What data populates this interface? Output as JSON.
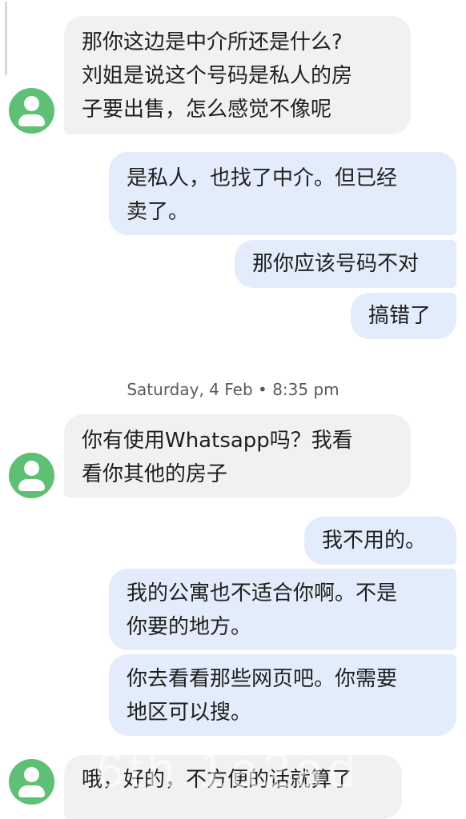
{
  "conversation": {
    "messages": [
      {
        "direction": "incoming",
        "text": "那你这边是中介所还是什么?\n刘姐是说这个号码是私人的房\n子要出售，怎么感觉不像呢"
      },
      {
        "direction": "outgoing",
        "text": "是私人，也找了中介。但已经\n卖了。"
      },
      {
        "direction": "outgoing",
        "text": "那你应该号码不对"
      },
      {
        "direction": "outgoing",
        "text": "搞错了"
      },
      {
        "direction": "incoming",
        "text": "你有使用Whatsapp吗？我看\n看你其他的房子"
      },
      {
        "direction": "outgoing",
        "text": "我不用的。"
      },
      {
        "direction": "outgoing",
        "text": "我的公寓也不适合你啊。不是\n你要的地方。"
      },
      {
        "direction": "outgoing",
        "text": "你去看看那些网页吧。你需要\n地区可以搜。"
      },
      {
        "direction": "incoming",
        "text": "哦，好的，不方便的话就算了"
      }
    ],
    "timestamp": "Saturday, 4 Feb • 8:35 pm"
  },
  "avatar": {
    "icon": "person-icon",
    "color": "#5fbf75"
  },
  "watermark": {
    "text": "6th  1a2ad"
  },
  "colors": {
    "incoming_bubble": "#f1f1f1",
    "outgoing_bubble": "#e3ecfb"
  }
}
